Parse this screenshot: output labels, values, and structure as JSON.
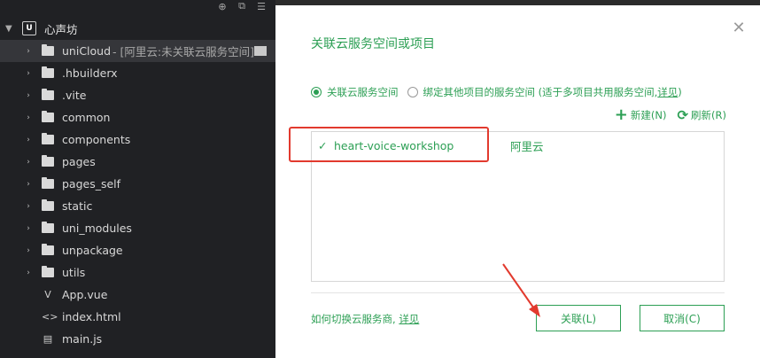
{
  "explorer": {
    "project_name": "心声坊",
    "root_icon_letter": "U",
    "items": [
      {
        "name": "uniCloud",
        "hint": "- [阿里云:未关联云服务空间]",
        "type": "folder",
        "expandable": true,
        "selected": true
      },
      {
        "name": ".hbuilderx",
        "type": "folder",
        "expandable": true
      },
      {
        "name": ".vite",
        "type": "folder",
        "expandable": true
      },
      {
        "name": "common",
        "type": "folder",
        "expandable": true
      },
      {
        "name": "components",
        "type": "folder",
        "expandable": true
      },
      {
        "name": "pages",
        "type": "folder",
        "expandable": true
      },
      {
        "name": "pages_self",
        "type": "folder",
        "expandable": true
      },
      {
        "name": "static",
        "type": "folder",
        "expandable": true
      },
      {
        "name": "uni_modules",
        "type": "folder",
        "expandable": true
      },
      {
        "name": "unpackage",
        "type": "folder",
        "expandable": true
      },
      {
        "name": "utils",
        "type": "folder",
        "expandable": true
      },
      {
        "name": "App.vue",
        "type": "vue-file",
        "expandable": false
      },
      {
        "name": "index.html",
        "type": "html-file",
        "expandable": false
      },
      {
        "name": "main.js",
        "type": "js-file",
        "expandable": false
      }
    ]
  },
  "dialog": {
    "title": "关联云服务空间或项目",
    "radio_option1": "关联云服务空间",
    "radio_option2": "绑定其他项目的服务空间 (适于多项目共用服务空间,",
    "radio_option2_link": "详见",
    "radio_option2_end": ")",
    "new_label": "新建(N)",
    "refresh_label": "刷新(R)",
    "spaces": [
      {
        "name": "heart-voice-workshop",
        "provider": "阿里云",
        "checked": true
      }
    ],
    "howto_text": "如何切换云服务商,",
    "howto_link": "详见",
    "ok_label": "关联(L)",
    "cancel_label": "取消(C)"
  },
  "colors": {
    "accent_green": "#2c9f54",
    "annotation_red": "#e23a2e",
    "sidebar_bg": "#202124"
  }
}
